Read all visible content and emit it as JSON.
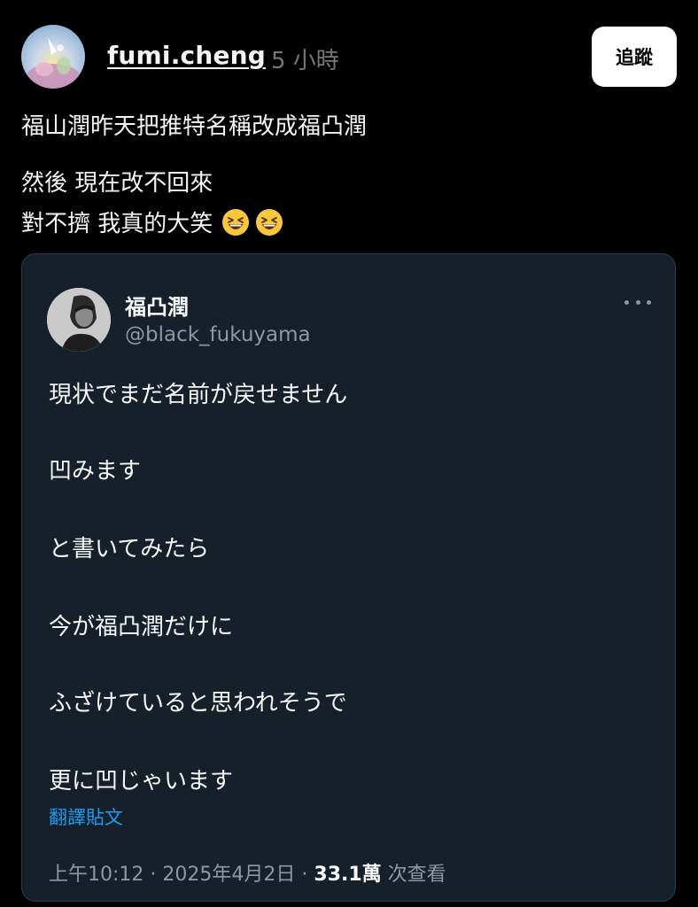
{
  "post": {
    "username": "fumi.cheng",
    "time": "5 小時",
    "follow_label": "追蹤",
    "lines": [
      "福山潤昨天把推特名稱改成福凸潤",
      "然後 現在改不回來",
      "對不擠 我真的大笑"
    ],
    "emoji": [
      "grinning-squinting-face-emoji",
      "grinning-squinting-face-emoji"
    ]
  },
  "embed": {
    "display_name": "福凸潤",
    "handle": "@black_fukuyama",
    "lines": [
      "現状でまだ名前が戻せません",
      "凹みます",
      "と書いてみたら",
      "今が福凸潤だけに",
      "ふざけていると思われそうで",
      "更に凹じゃいます"
    ],
    "translate_label": "翻譯貼文",
    "meta": {
      "time": "上午10:12",
      "sep1": "·",
      "date": "2025年4月2日",
      "sep2": "·",
      "views": "33.1萬",
      "views_label": "次查看"
    }
  },
  "colors": {
    "background": "#000000",
    "embed_background": "#15202b",
    "link": "#1d9bf0",
    "muted": "#8b98a5"
  }
}
